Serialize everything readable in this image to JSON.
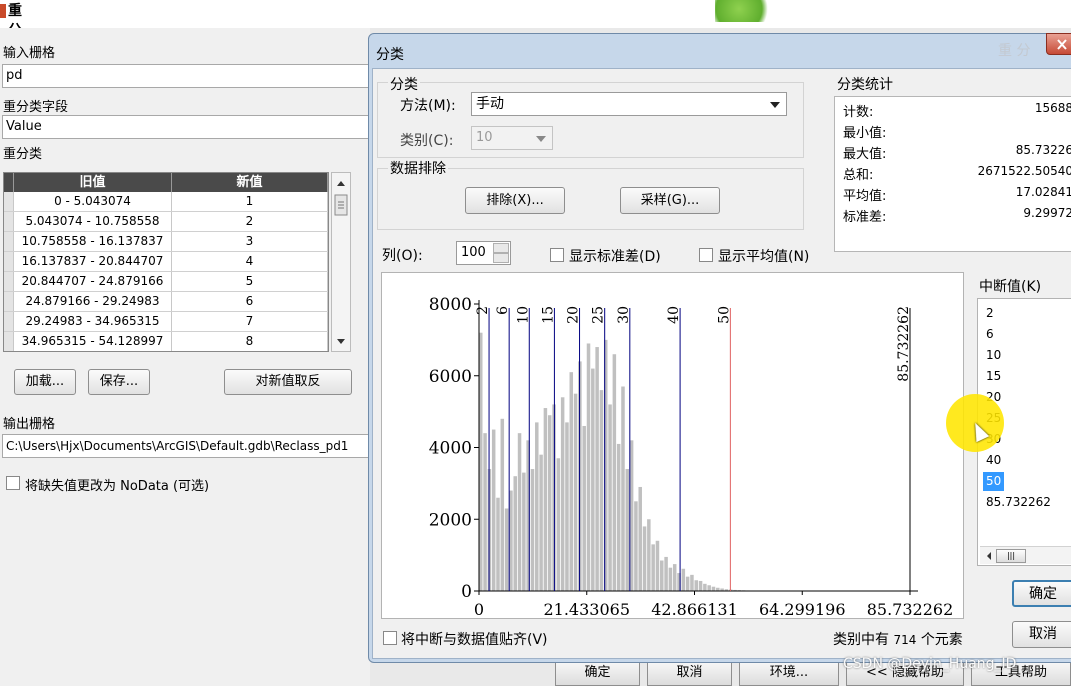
{
  "tool": {
    "title": "重分类",
    "input_raster_label": "输入栅格",
    "input_raster_value": "pd",
    "reclass_field_label": "重分类字段",
    "reclass_field_value": "Value",
    "reclass_label": "重分类",
    "table": {
      "headers": [
        "旧值",
        "新值"
      ],
      "rows": [
        [
          "0 - 5.043074",
          "1"
        ],
        [
          "5.043074 - 10.758558",
          "2"
        ],
        [
          "10.758558 - 16.137837",
          "3"
        ],
        [
          "16.137837 - 20.844707",
          "4"
        ],
        [
          "20.844707 - 24.879166",
          "5"
        ],
        [
          "24.879166 - 29.24983",
          "6"
        ],
        [
          "29.24983 - 34.965315",
          "7"
        ],
        [
          "34.965315 - 54.128997",
          "8"
        ]
      ]
    },
    "load_button": "加载...",
    "save_button": "保存...",
    "reverse_button": "对新值取反",
    "output_raster_label": "输出栅格",
    "output_raster_value": "C:\\Users\\Hjx\\Documents\\ArcGIS\\Default.gdb\\Reclass_pd1",
    "nodata_checkbox_label": "将缺失值更改为 NoData (可选)"
  },
  "bottom_buttons": {
    "ok": "确定",
    "cancel": "取消",
    "env": "环境...",
    "hide_help": "<< 隐藏帮助",
    "tool_help": "工具帮助"
  },
  "dialog": {
    "title": "分类",
    "ghost_title": "重 分",
    "classification_group": "分类",
    "method_label": "方法(M):",
    "method_value": "手动",
    "classes_label": "类别(C):",
    "classes_value": "10",
    "exclusion_group": "数据排除",
    "exclude_button": "排除(X)...",
    "sample_button": "采样(G)...",
    "stats_group": "分类统计",
    "stats": [
      {
        "key": "计数:",
        "value": "15688"
      },
      {
        "key": "最小值:",
        "value": ""
      },
      {
        "key": "最大值:",
        "value": "85.73226"
      },
      {
        "key": "总和:",
        "value": "2671522.50540"
      },
      {
        "key": "平均值:",
        "value": "17.02841"
      },
      {
        "key": "标准差:",
        "value": "9.29972"
      }
    ],
    "columns_label": "列(O):",
    "columns_value": "100",
    "show_std_label": "显示标准差(D)",
    "show_mean_label": "显示平均值(N)",
    "breaks_label": "中断值(K)",
    "breaks": [
      "2",
      "6",
      "10",
      "15",
      "20",
      "25",
      "30",
      "40",
      "50",
      "85.732262"
    ],
    "selected_break": "50",
    "snap_label": "将中断与数据值贴齐(V)",
    "elements_prefix": "类别中有",
    "elements_count": "714",
    "elements_suffix": "个元素",
    "ok_button": "确定",
    "cancel_button": "取消"
  },
  "watermark": "CSDN @Deyin_Huang_ID",
  "colors": {
    "histogram_bar": "#c0c0c0",
    "break_line": "#000080",
    "selected_break_line": "#e06060",
    "selection": "#3399ff",
    "cursor_highlight": "#ffe600"
  },
  "chart_data": {
    "type": "bar",
    "title": "",
    "xlabel": "",
    "ylabel": "",
    "xlim": [
      0,
      85.732262
    ],
    "ylim": [
      0,
      8000
    ],
    "yticks": [
      "0",
      "2000",
      "4000",
      "6000",
      "8000"
    ],
    "xticks": [
      "0",
      "21.433065",
      "42.866131",
      "64.299196",
      "85.732262"
    ],
    "xtick_values": [
      0,
      21.433065,
      42.866131,
      64.299196,
      85.732262
    ],
    "bin_width": 0.857323,
    "bins": [
      7200,
      4400,
      3400,
      4500,
      2600,
      4800,
      2300,
      2800,
      3200,
      4400,
      3300,
      4200,
      3400,
      4700,
      3800,
      5100,
      4900,
      5200,
      3700,
      5400,
      4700,
      6100,
      5500,
      6400,
      4600,
      6900,
      6200,
      6800,
      5600,
      7000,
      5200,
      6600,
      4100,
      5700,
      3400,
      4200,
      2500,
      2900,
      1800,
      2000,
      1300,
      1400,
      850,
      950,
      650,
      750,
      500,
      620,
      400,
      450,
      300,
      280,
      200,
      160,
      120,
      90,
      70,
      50,
      40,
      30,
      25,
      20,
      15,
      10,
      8,
      6,
      5,
      4,
      3,
      2,
      2,
      1,
      1,
      1,
      0,
      0,
      0,
      0,
      0,
      0,
      0,
      0,
      0,
      0,
      0,
      0,
      0,
      0,
      0,
      0,
      0,
      0,
      0,
      0,
      0,
      0,
      0,
      0,
      0,
      0
    ],
    "break_values": [
      2,
      6,
      10,
      15,
      20,
      25,
      30,
      40,
      50,
      85.732262
    ],
    "break_labels": [
      "2",
      "6",
      "10",
      "15",
      "20",
      "25",
      "30",
      "40",
      "50",
      "85.732262"
    ],
    "selected_break_value": 50
  }
}
